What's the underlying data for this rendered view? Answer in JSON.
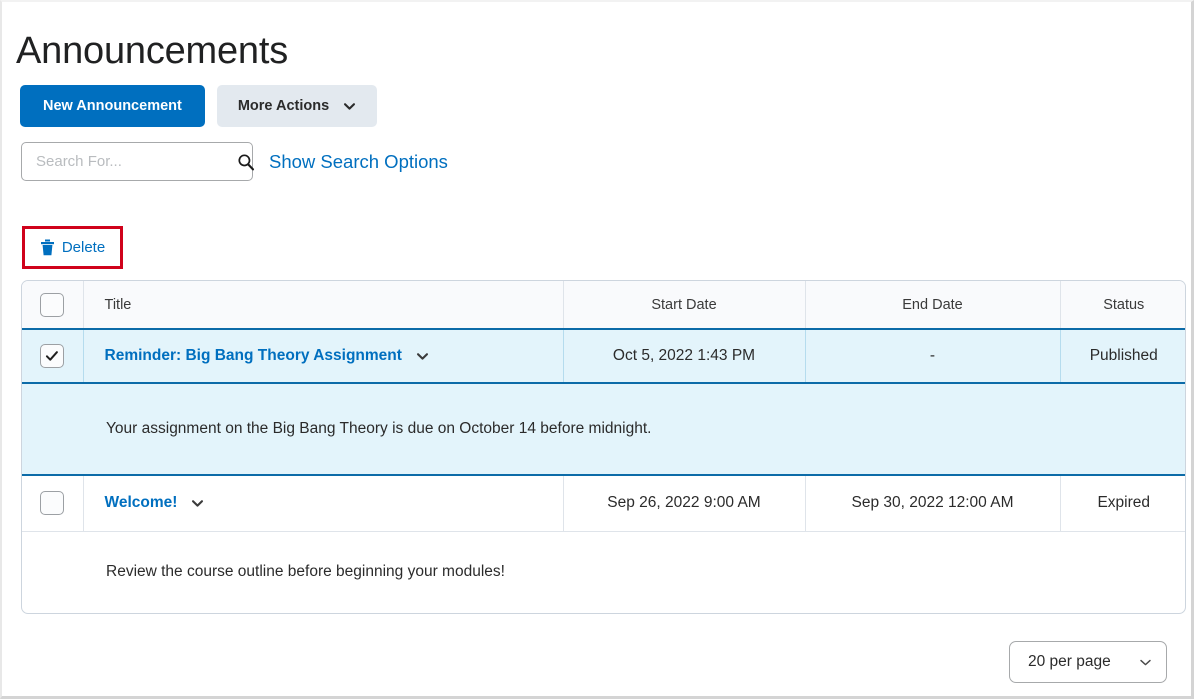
{
  "page": {
    "title": "Announcements"
  },
  "toolbar": {
    "new_announcement_label": "New Announcement",
    "more_actions_label": "More Actions"
  },
  "search": {
    "value": "",
    "placeholder": "Search For...",
    "show_options_label": "Show Search Options"
  },
  "actions": {
    "delete_label": "Delete",
    "highlight_color": "#d0021b"
  },
  "table": {
    "columns": [
      "",
      "Title",
      "Start Date",
      "End Date",
      "Status"
    ],
    "rows": [
      {
        "checked": true,
        "selected": true,
        "title": "Reminder: Big Bang Theory Assignment",
        "start_date": "Oct 5, 2022 1:43 PM",
        "end_date": "-",
        "status": "Published",
        "body": "Your assignment on the Big Bang Theory is due on October 14 before midnight."
      },
      {
        "checked": false,
        "selected": false,
        "title": "Welcome!",
        "start_date": "Sep 26, 2022 9:00 AM",
        "end_date": "Sep 30, 2022 12:00 AM",
        "status": "Expired",
        "body": "Review the course outline before beginning your modules!"
      }
    ]
  },
  "pagination": {
    "per_page_label": "20 per page"
  },
  "colors": {
    "primary_blue": "#006fbf",
    "link_blue": "#006fbf",
    "selected_row_bg": "#e3f4fb",
    "selected_row_border": "#0c6ba8",
    "header_bg": "#f9fafc",
    "grid_border": "#cdd5de"
  }
}
